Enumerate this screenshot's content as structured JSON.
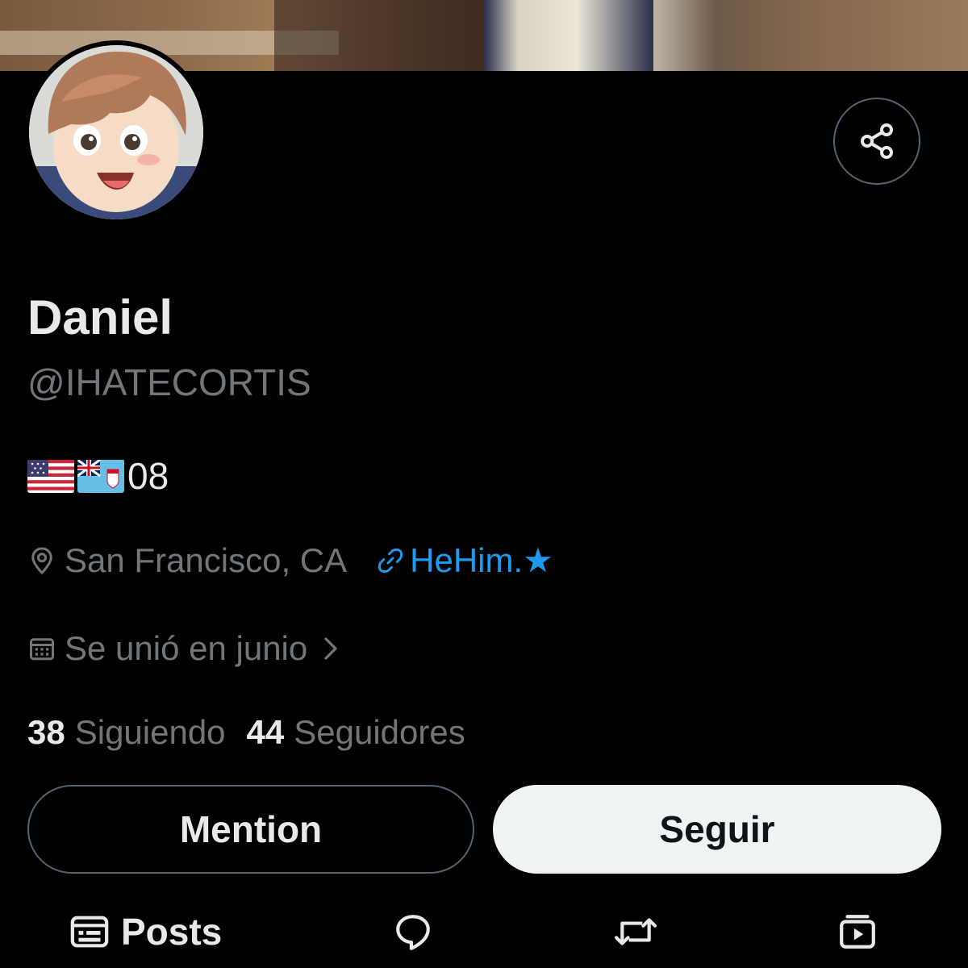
{
  "profile": {
    "name": "Daniel",
    "handle": "@IHATECORTIS",
    "bio_text": "08",
    "bio_flags": [
      "us-flag",
      "fiji-flag"
    ],
    "location": "San Francisco, CA",
    "link": "HeHim.★",
    "joined": "Se unió en junio"
  },
  "stats": {
    "following_count": "38",
    "following_label": "Siguiendo",
    "followers_count": "44",
    "followers_label": "Seguidores"
  },
  "actions": {
    "mention_label": "Mention",
    "follow_label": "Seguir"
  },
  "tabs": {
    "posts_label": "Posts",
    "icons": [
      "posts-icon",
      "replies-icon",
      "reposts-icon",
      "media-icon"
    ]
  },
  "icons": {
    "share": "share-icon",
    "location": "location-icon",
    "link": "link-icon",
    "calendar": "calendar-icon",
    "chevron": "chevron-right-icon"
  },
  "colors": {
    "background": "#000000",
    "primary_text": "#e7e9ea",
    "secondary_text": "#71767b",
    "link": "#1d9bf0",
    "follow_button": "#eff3f4",
    "border": "#536471"
  }
}
